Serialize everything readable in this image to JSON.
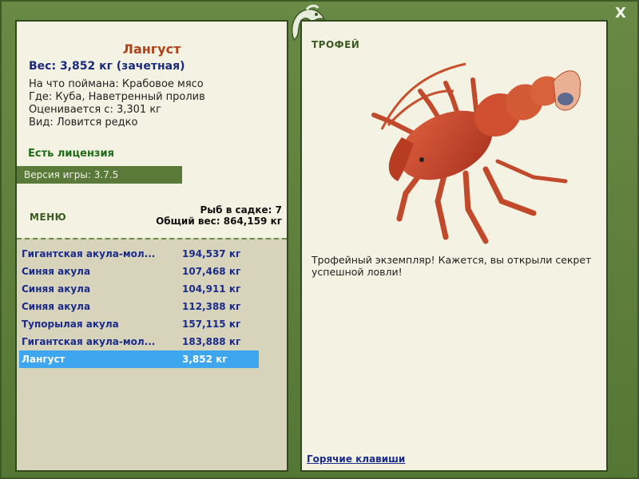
{
  "close_glyph": "X",
  "fish": {
    "title": "Лангуст",
    "weight_line": "Вес: 3,852 кг (зачетная)",
    "caught_on": "На что поймана: Крабовое мясо",
    "location": "Где: Куба, Наветренный пролив",
    "valued_from": "Оценивается с: 3,301 кг",
    "rarity": "Вид: Ловится редко"
  },
  "license": "Есть лицензия",
  "version": "Версия игры: 3.7.5",
  "menu_label": "МЕНЮ",
  "stats": {
    "fish_in_net": "Рыб в садке: 7",
    "total_weight": "Общий вес: 864,159 кг"
  },
  "catch_list": [
    {
      "name": "Гигантская акула-мол...",
      "weight": "194,537 кг"
    },
    {
      "name": "Синяя акула",
      "weight": "107,468 кг"
    },
    {
      "name": "Синяя акула",
      "weight": "104,911 кг"
    },
    {
      "name": "Синяя акула",
      "weight": "112,388 кг"
    },
    {
      "name": "Тупорылая акула",
      "weight": "157,115 кг"
    },
    {
      "name": "Гигантская акула-мол...",
      "weight": "183,888 кг"
    },
    {
      "name": "Лангуст",
      "weight": "3,852 кг"
    }
  ],
  "trophy": {
    "label": "ТРОФЕЙ",
    "text": "Трофейный экземпляр! Кажется, вы открыли секрет успешной ловли!"
  },
  "hotkeys": "Горячие клавиши",
  "colors": {
    "frame": "#5a7a3a",
    "panel": "#f4f2e2",
    "selected": "#3ea6ee",
    "title": "#b0421a",
    "link": "#1a2b8a"
  }
}
